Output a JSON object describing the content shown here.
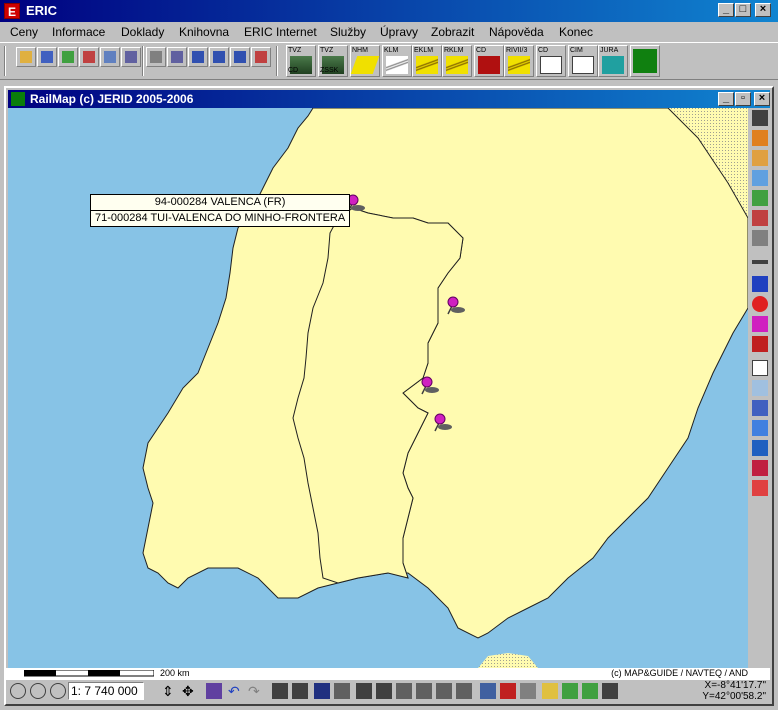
{
  "app": {
    "title": "ERIC",
    "icon_letter": "E"
  },
  "window_buttons": {
    "minimize": "_",
    "maximize": "□",
    "close": "×"
  },
  "menu": [
    {
      "label": "Ceny"
    },
    {
      "label": "Informace"
    },
    {
      "label": "Doklady"
    },
    {
      "label": "Knihovna"
    },
    {
      "label": "ERIC Internet"
    },
    {
      "label": "Služby"
    },
    {
      "label": "Úpravy"
    },
    {
      "label": "Zobrazit"
    },
    {
      "label": "Nápověda"
    },
    {
      "label": "Konec"
    }
  ],
  "toolbar_big": [
    {
      "top": "TVZ",
      "bottom": "CD"
    },
    {
      "top": "TVZ",
      "bottom": "ZSSK"
    },
    {
      "top": "NHM",
      "bottom": ""
    },
    {
      "top": "KLM",
      "bottom": ""
    },
    {
      "top": "EKLM",
      "bottom": ""
    },
    {
      "top": "RKLM",
      "bottom": ""
    },
    {
      "top": "CD",
      "bottom": ""
    },
    {
      "top": "RIVII/3",
      "bottom": ""
    },
    {
      "top": "CD",
      "bottom": ""
    },
    {
      "top": "CIM",
      "bottom": ""
    },
    {
      "top": "JURA",
      "bottom": ""
    }
  ],
  "child_window": {
    "title": "RailMap (c) JERID 2005-2006",
    "buttons": {
      "minimize": "_",
      "restore": "▫",
      "close": "×"
    }
  },
  "tooltip": {
    "line1": "94-000284 VALENCA (FR)",
    "line2": "71-000284 TUI-VALENCA DO MINHO-FRONTERA"
  },
  "scale": {
    "label": "200 km",
    "copyright": "(c) MAP&GUIDE / NAVTEQ / AND"
  },
  "zoom": {
    "value": "1: 7 740 000"
  },
  "coords": {
    "x": "X=-8°41'17.7\"",
    "y": "Y=42°00'58.2\""
  },
  "colors": {
    "sea": "#87c3e6",
    "land": "#fffbb0",
    "pin": "#d020c0"
  }
}
